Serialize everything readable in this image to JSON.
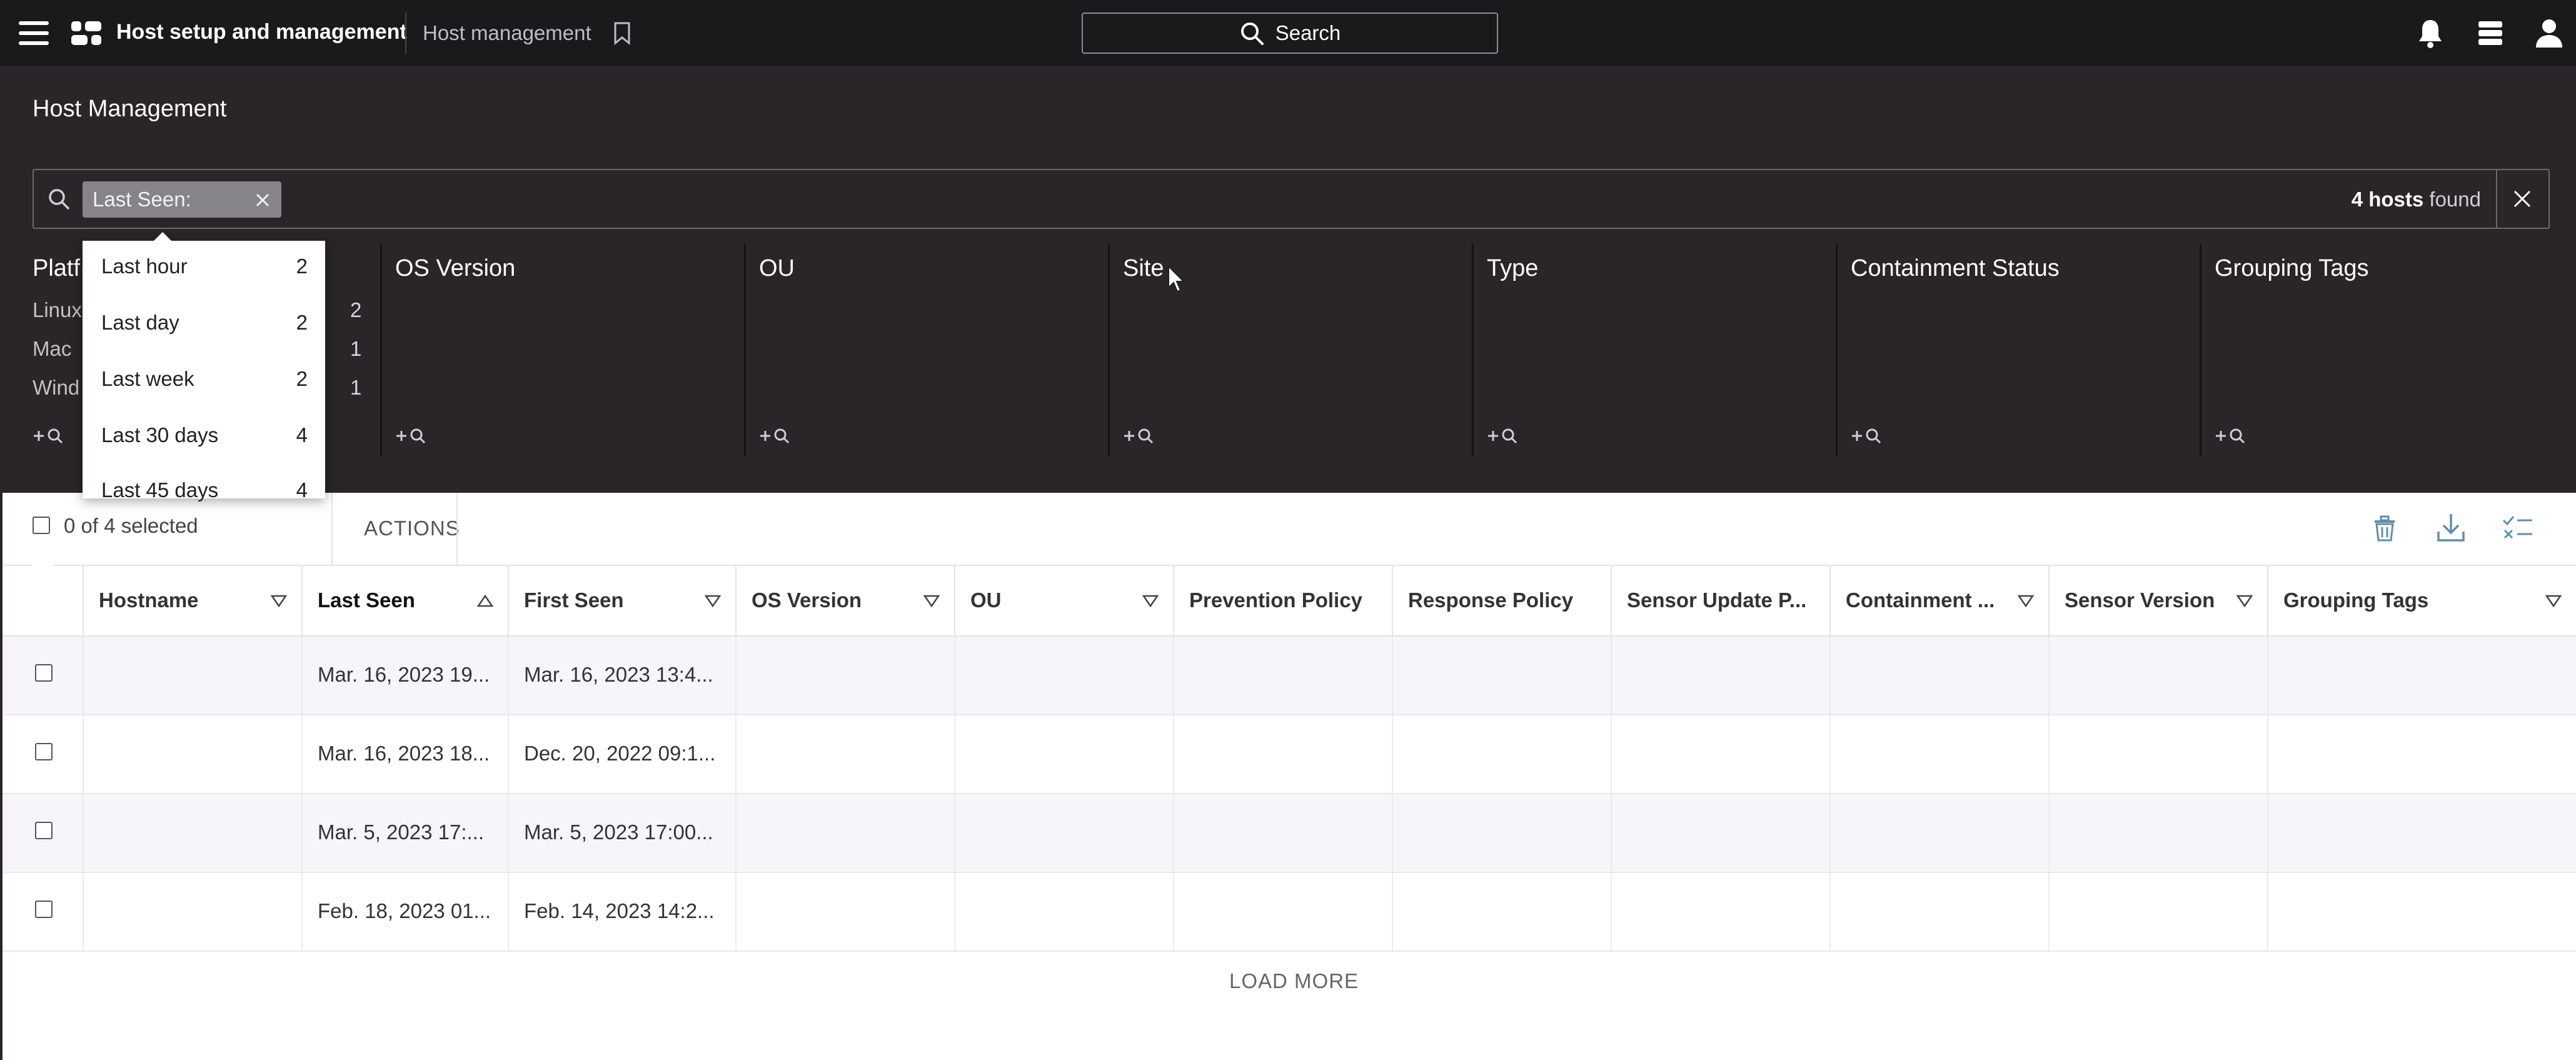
{
  "topbar": {
    "app_title": "Host setup and management",
    "breadcrumb": "Host management",
    "search_label": "Search",
    "icons": [
      "menu-icon",
      "app-logo-icon",
      "bookmark-icon",
      "search-icon",
      "bell-icon",
      "switcher-icon",
      "user-icon"
    ]
  },
  "panel": {
    "title": "Host Management",
    "filter_chip": "Last Seen:",
    "hosts_found_count": "4 hosts",
    "hosts_found_suffix": "found"
  },
  "facets": {
    "platform": {
      "label": "Platf",
      "rows": [
        {
          "label": "Linux",
          "count": "2"
        },
        {
          "label": "Mac",
          "count": "1"
        },
        {
          "label": "Wind",
          "count": "1"
        }
      ]
    },
    "others": [
      "OS Version",
      "OU",
      "Site",
      "Type",
      "Containment Status",
      "Grouping Tags"
    ]
  },
  "dropdown": {
    "items": [
      {
        "label": "Last hour",
        "count": "2"
      },
      {
        "label": "Last day",
        "count": "2"
      },
      {
        "label": "Last week",
        "count": "2"
      },
      {
        "label": "Last 30 days",
        "count": "4"
      },
      {
        "label": "Last 45 days",
        "count": "4"
      }
    ]
  },
  "toolbar": {
    "selection": "0 of 4 selected",
    "actions_label": "ACTIONS"
  },
  "table": {
    "columns": [
      "Hostname",
      "Last Seen",
      "First Seen",
      "OS Version",
      "OU",
      "Prevention Policy",
      "Response Policy",
      "Sensor Update P...",
      "Containment ...",
      "Sensor Version",
      "Grouping Tags"
    ],
    "rows": [
      {
        "last_seen": "Mar. 16, 2023 19...",
        "first_seen": "Mar. 16, 2023 13:4..."
      },
      {
        "last_seen": "Mar. 16, 2023 18...",
        "first_seen": "Dec. 20, 2022 09:1..."
      },
      {
        "last_seen": "Mar. 5, 2023 17:...",
        "first_seen": "Mar. 5, 2023 17:00..."
      },
      {
        "last_seen": "Feb. 18, 2023 01...",
        "first_seen": "Feb. 14, 2023 14:2..."
      }
    ],
    "load_more": "LOAD MORE"
  },
  "colors": {
    "topbar_bg": "#1a1a1d",
    "panel_bg": "#2a2529",
    "chip_bg": "#87838a",
    "row_alt_bg": "#f7f5f9"
  }
}
